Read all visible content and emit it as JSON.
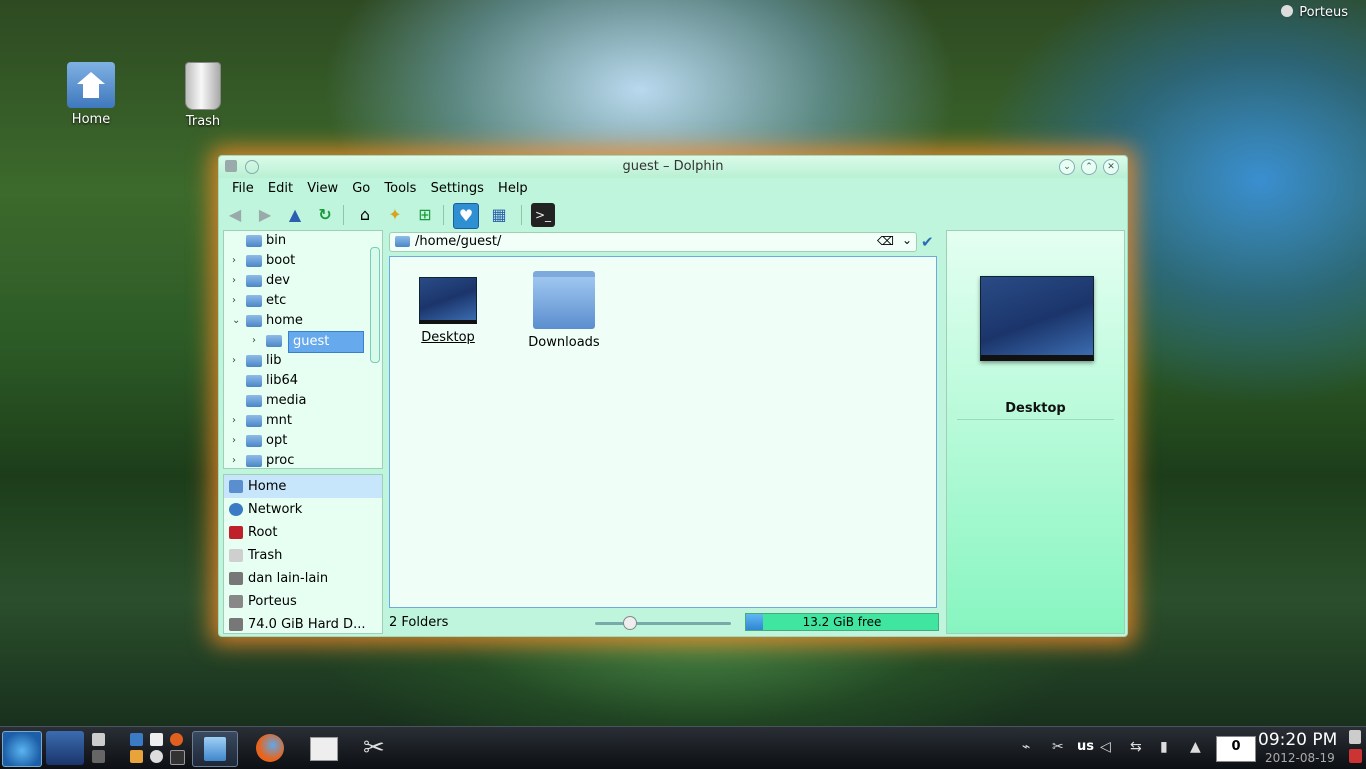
{
  "desktop": {
    "brand": "Porteus",
    "icons": [
      {
        "label": "Home"
      },
      {
        "label": "Trash"
      }
    ]
  },
  "window": {
    "title": "guest – Dolphin",
    "menu": [
      "File",
      "Edit",
      "View",
      "Go",
      "Tools",
      "Settings",
      "Help"
    ],
    "tree": [
      {
        "label": "bin",
        "expander": ""
      },
      {
        "label": "boot",
        "expander": "›"
      },
      {
        "label": "dev",
        "expander": "›"
      },
      {
        "label": "etc",
        "expander": "›"
      },
      {
        "label": "home",
        "expander": "⌄"
      },
      {
        "label": "guest",
        "expander": "›"
      },
      {
        "label": "lib",
        "expander": "›"
      },
      {
        "label": "lib64",
        "expander": ""
      },
      {
        "label": "media",
        "expander": ""
      },
      {
        "label": "mnt",
        "expander": "›"
      },
      {
        "label": "opt",
        "expander": "›"
      },
      {
        "label": "proc",
        "expander": "›"
      }
    ],
    "places": [
      {
        "label": "Home",
        "color": "#5b8ecf"
      },
      {
        "label": "Network",
        "color": "#3b7bc5"
      },
      {
        "label": "Root",
        "color": "#c0202a"
      },
      {
        "label": "Trash",
        "color": "#cfcfcf"
      },
      {
        "label": "dan lain-lain",
        "color": "#777777"
      },
      {
        "label": "Porteus",
        "color": "#888888"
      },
      {
        "label": "74.0 GiB Hard D...",
        "color": "#777777"
      }
    ],
    "location": "/home/guest/",
    "items": [
      {
        "label": "Desktop"
      },
      {
        "label": "Downloads"
      }
    ],
    "info": {
      "name": "Desktop"
    },
    "status": {
      "text": "2 Folders",
      "zoom": 0.25,
      "free": "13.2 GiB free",
      "used_fraction": 0.09
    }
  },
  "taskbar": {
    "keyboard": "us",
    "mail_count": "0",
    "time": "09:20 PM",
    "date": "2012-08-19"
  }
}
